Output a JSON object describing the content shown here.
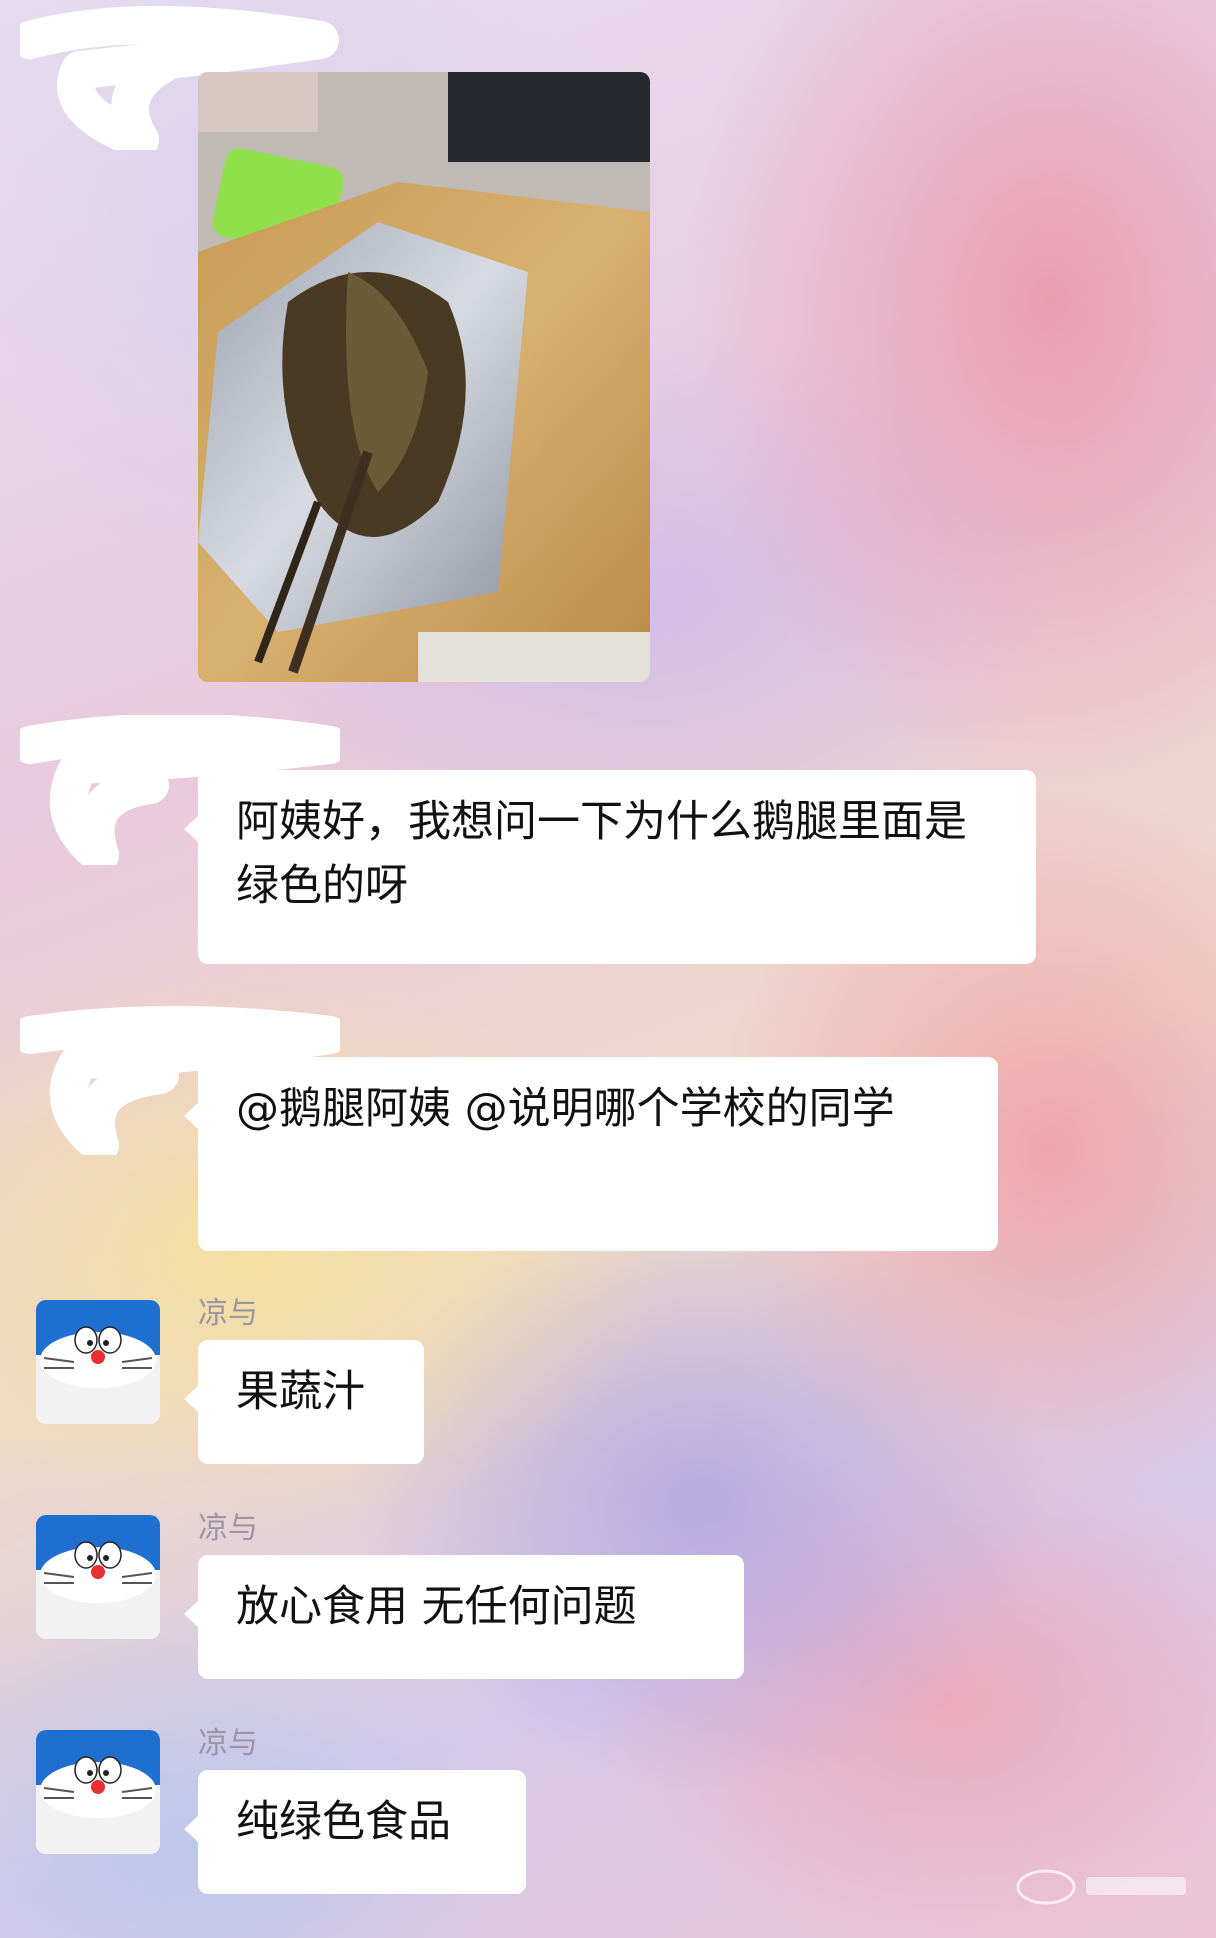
{
  "messages": [
    {
      "type": "image",
      "sender": "",
      "content": "photo of goose leg with green inside"
    },
    {
      "type": "text",
      "sender": "",
      "text": "阿姨好，我想问一下为什么鹅腿里面是绿色的呀"
    },
    {
      "type": "text",
      "sender": "",
      "text": "@鹅腿阿姨 @说明哪个学校的同学"
    },
    {
      "type": "text",
      "sender": "凉与",
      "text": "果蔬汁"
    },
    {
      "type": "text",
      "sender": "凉与",
      "text": "放心食用 无任何问题"
    },
    {
      "type": "text",
      "sender": "凉与",
      "text": "纯绿色食品"
    }
  ],
  "avatar_icon": "doraemon-avatar-icon",
  "colors": {
    "bubble": "#ffffff",
    "sender_name": "#9b95a5",
    "text": "#111111"
  }
}
